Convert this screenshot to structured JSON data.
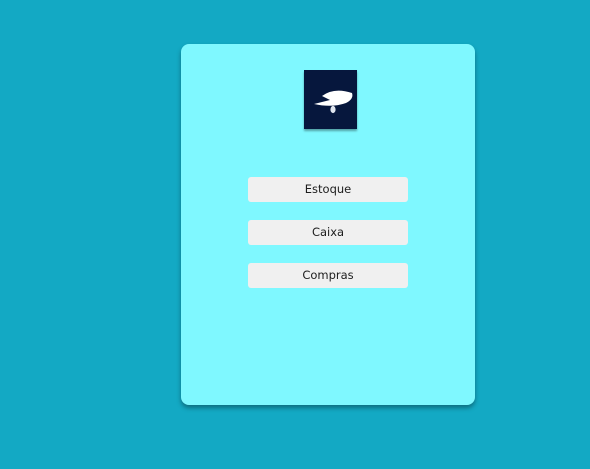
{
  "menu": {
    "logo_icon": "hang-glider-logo-icon",
    "buttons": [
      {
        "label": "Estoque"
      },
      {
        "label": "Caixa"
      },
      {
        "label": "Compras"
      }
    ]
  },
  "colors": {
    "background": "#13a9c4",
    "card": "#7ff8ff",
    "logo_background": "#06173d",
    "button": "#f0f0f0"
  }
}
